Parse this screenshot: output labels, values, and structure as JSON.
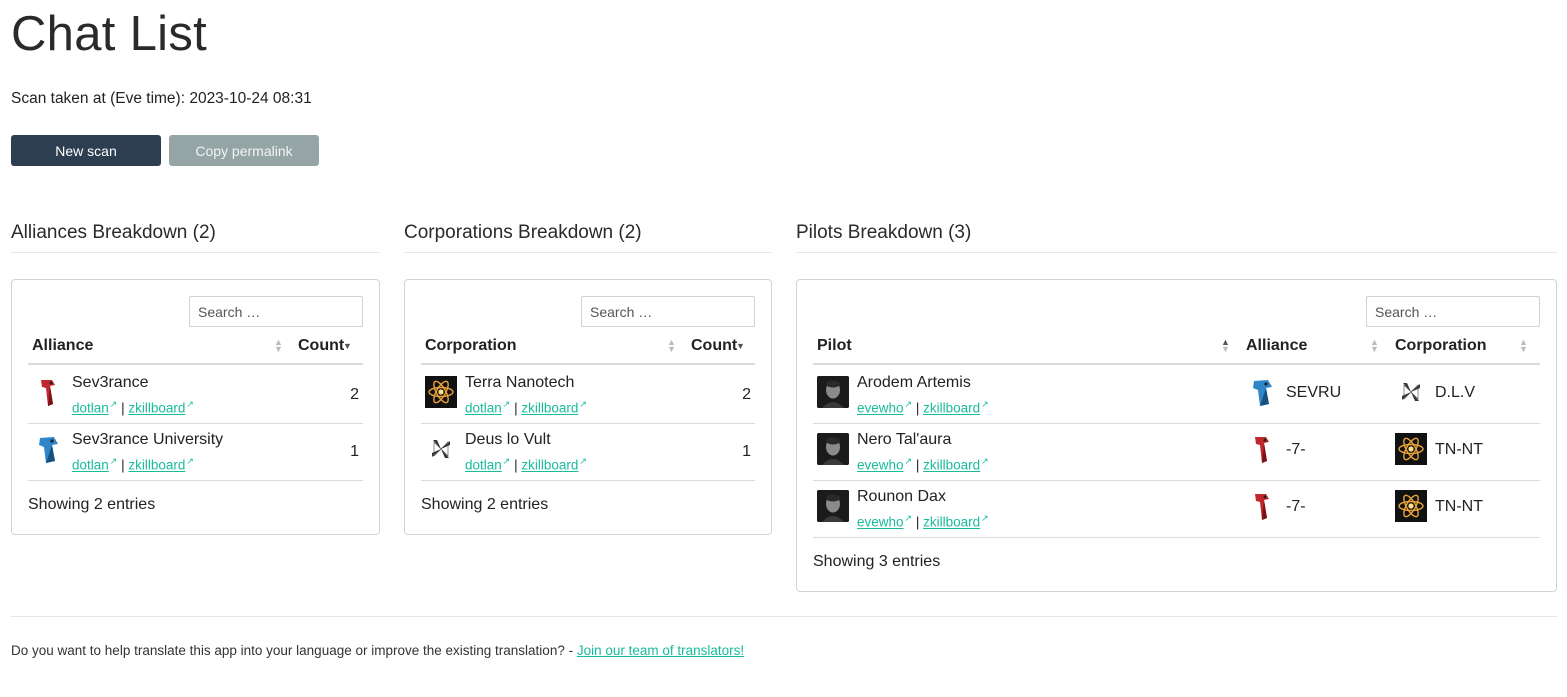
{
  "page": {
    "title": "Chat List",
    "scan_time": "Scan taken at (Eve time): 2023-10-24 08:31",
    "new_scan": "New scan",
    "copy_permalink": "Copy permalink"
  },
  "alliances": {
    "heading": "Alliances Breakdown (2)",
    "search_placeholder": "Search …",
    "col_name": "Alliance",
    "col_count": "Count",
    "rows": [
      {
        "name": "Sev3rance",
        "link1": "dotlan",
        "link2": "zkillboard",
        "count": "2",
        "icon": "sev3rance-logo"
      },
      {
        "name": "Sev3rance University",
        "link1": "dotlan",
        "link2": "zkillboard",
        "count": "1",
        "icon": "sevru-logo"
      }
    ],
    "showing": "Showing 2 entries"
  },
  "corporations": {
    "heading": "Corporations Breakdown (2)",
    "search_placeholder": "Search …",
    "col_name": "Corporation",
    "col_count": "Count",
    "rows": [
      {
        "name": "Terra Nanotech",
        "link1": "dotlan",
        "link2": "zkillboard",
        "count": "2",
        "icon": "atom-logo"
      },
      {
        "name": "Deus lo Vult",
        "link1": "dotlan",
        "link2": "zkillboard",
        "count": "1",
        "icon": "cross-logo"
      }
    ],
    "showing": "Showing 2 entries"
  },
  "pilots": {
    "heading": "Pilots Breakdown (3)",
    "search_placeholder": "Search …",
    "col_pilot": "Pilot",
    "col_alliance": "Alliance",
    "col_corporation": "Corporation",
    "rows": [
      {
        "name": "Arodem Artemis",
        "link1": "evewho",
        "link2": "zkillboard",
        "alliance": "SEVRU",
        "corporation": "D.L.V"
      },
      {
        "name": "Nero Tal'aura",
        "link1": "evewho",
        "link2": "zkillboard",
        "alliance": "-7-",
        "corporation": "TN-NT"
      },
      {
        "name": "Rounon Dax",
        "link1": "evewho",
        "link2": "zkillboard",
        "alliance": "-7-",
        "corporation": "TN-NT"
      }
    ],
    "showing": "Showing 3 entries"
  },
  "footer": {
    "text": "Do you want to help translate this app into your language or improve the existing translation? -",
    "link": "Join our team of translators!"
  },
  "colors": {
    "primary": "#2c3e50",
    "secondary": "#95a5a6",
    "link": "#18bc9c"
  }
}
